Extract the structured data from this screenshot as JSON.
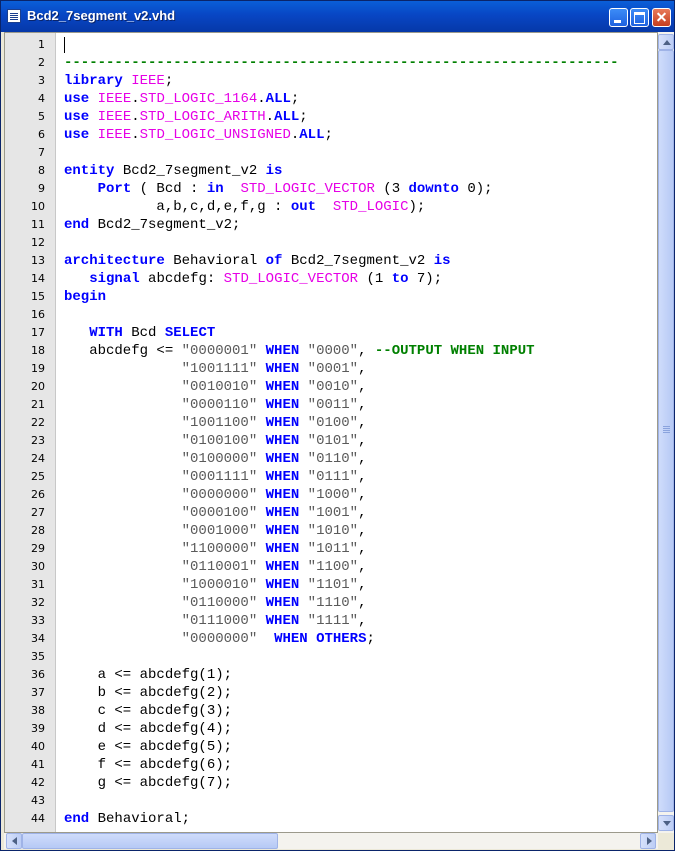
{
  "window": {
    "title": "Bcd2_7segment_v2.vhd"
  },
  "colors": {
    "keyword": "#0000ff",
    "type": "#e600e6",
    "comment": "#008000",
    "gutter": "#e6e6e6",
    "titlebar": "#0a5fd8"
  },
  "editor": {
    "lines": [
      {
        "n": "1",
        "tokens": []
      },
      {
        "n": "2",
        "tokens": [
          {
            "t": "------------------------------------------------------------------",
            "c": "cm"
          }
        ]
      },
      {
        "n": "3",
        "tokens": [
          {
            "t": "library",
            "c": "kw"
          },
          {
            "t": " "
          },
          {
            "t": "IEEE",
            "c": "ty"
          },
          {
            "t": ";"
          }
        ]
      },
      {
        "n": "4",
        "tokens": [
          {
            "t": "use",
            "c": "kw"
          },
          {
            "t": " "
          },
          {
            "t": "IEEE",
            "c": "ty"
          },
          {
            "t": "."
          },
          {
            "t": "STD_LOGIC_1164",
            "c": "ty"
          },
          {
            "t": "."
          },
          {
            "t": "ALL",
            "c": "kw"
          },
          {
            "t": ";"
          }
        ]
      },
      {
        "n": "5",
        "tokens": [
          {
            "t": "use",
            "c": "kw"
          },
          {
            "t": " "
          },
          {
            "t": "IEEE",
            "c": "ty"
          },
          {
            "t": "."
          },
          {
            "t": "STD_LOGIC_ARITH",
            "c": "ty"
          },
          {
            "t": "."
          },
          {
            "t": "ALL",
            "c": "kw"
          },
          {
            "t": ";"
          }
        ]
      },
      {
        "n": "6",
        "tokens": [
          {
            "t": "use",
            "c": "kw"
          },
          {
            "t": " "
          },
          {
            "t": "IEEE",
            "c": "ty"
          },
          {
            "t": "."
          },
          {
            "t": "STD_LOGIC_UNSIGNED",
            "c": "ty"
          },
          {
            "t": "."
          },
          {
            "t": "ALL",
            "c": "kw"
          },
          {
            "t": ";"
          }
        ]
      },
      {
        "n": "7",
        "tokens": []
      },
      {
        "n": "8",
        "tokens": [
          {
            "t": "entity",
            "c": "kw"
          },
          {
            "t": " Bcd2_7segment_v2 "
          },
          {
            "t": "is",
            "c": "kw"
          }
        ]
      },
      {
        "n": "9",
        "tokens": [
          {
            "t": "    "
          },
          {
            "t": "Port",
            "c": "kw"
          },
          {
            "t": " ( Bcd : "
          },
          {
            "t": "in",
            "c": "kw"
          },
          {
            "t": "  "
          },
          {
            "t": "STD_LOGIC_VECTOR",
            "c": "ty"
          },
          {
            "t": " (3 "
          },
          {
            "t": "downto",
            "c": "kw"
          },
          {
            "t": " 0);"
          }
        ]
      },
      {
        "n": "10",
        "tokens": [
          {
            "t": "           a,b,c,d,e,f,g : "
          },
          {
            "t": "out",
            "c": "kw"
          },
          {
            "t": "  "
          },
          {
            "t": "STD_LOGIC",
            "c": "ty"
          },
          {
            "t": ");"
          }
        ]
      },
      {
        "n": "11",
        "tokens": [
          {
            "t": "end",
            "c": "kw"
          },
          {
            "t": " Bcd2_7segment_v2;"
          }
        ]
      },
      {
        "n": "12",
        "tokens": []
      },
      {
        "n": "13",
        "tokens": [
          {
            "t": "architecture",
            "c": "kw"
          },
          {
            "t": " Behavioral "
          },
          {
            "t": "of",
            "c": "kw"
          },
          {
            "t": " Bcd2_7segment_v2 "
          },
          {
            "t": "is",
            "c": "kw"
          }
        ]
      },
      {
        "n": "14",
        "tokens": [
          {
            "t": "   "
          },
          {
            "t": "signal",
            "c": "kw"
          },
          {
            "t": " abcdefg: "
          },
          {
            "t": "STD_LOGIC_VECTOR",
            "c": "ty"
          },
          {
            "t": " (1 "
          },
          {
            "t": "to",
            "c": "kw"
          },
          {
            "t": " 7);"
          }
        ]
      },
      {
        "n": "15",
        "tokens": [
          {
            "t": "begin",
            "c": "kw"
          }
        ]
      },
      {
        "n": "16",
        "tokens": []
      },
      {
        "n": "17",
        "tokens": [
          {
            "t": "   "
          },
          {
            "t": "WITH",
            "c": "kw"
          },
          {
            "t": " Bcd "
          },
          {
            "t": "SELECT",
            "c": "kw"
          }
        ]
      },
      {
        "n": "18",
        "tokens": [
          {
            "t": "   abcdefg <= "
          },
          {
            "t": "\"0000001\"",
            "c": "st"
          },
          {
            "t": " "
          },
          {
            "t": "WHEN",
            "c": "kw"
          },
          {
            "t": " "
          },
          {
            "t": "\"0000\"",
            "c": "st"
          },
          {
            "t": ", "
          },
          {
            "t": "--OUTPUT WHEN INPUT",
            "c": "cm"
          }
        ]
      },
      {
        "n": "19",
        "tokens": [
          {
            "t": "              "
          },
          {
            "t": "\"1001111\"",
            "c": "st"
          },
          {
            "t": " "
          },
          {
            "t": "WHEN",
            "c": "kw"
          },
          {
            "t": " "
          },
          {
            "t": "\"0001\"",
            "c": "st"
          },
          {
            "t": ","
          }
        ]
      },
      {
        "n": "20",
        "tokens": [
          {
            "t": "              "
          },
          {
            "t": "\"0010010\"",
            "c": "st"
          },
          {
            "t": " "
          },
          {
            "t": "WHEN",
            "c": "kw"
          },
          {
            "t": " "
          },
          {
            "t": "\"0010\"",
            "c": "st"
          },
          {
            "t": ","
          }
        ]
      },
      {
        "n": "21",
        "tokens": [
          {
            "t": "              "
          },
          {
            "t": "\"0000110\"",
            "c": "st"
          },
          {
            "t": " "
          },
          {
            "t": "WHEN",
            "c": "kw"
          },
          {
            "t": " "
          },
          {
            "t": "\"0011\"",
            "c": "st"
          },
          {
            "t": ","
          }
        ]
      },
      {
        "n": "22",
        "tokens": [
          {
            "t": "              "
          },
          {
            "t": "\"1001100\"",
            "c": "st"
          },
          {
            "t": " "
          },
          {
            "t": "WHEN",
            "c": "kw"
          },
          {
            "t": " "
          },
          {
            "t": "\"0100\"",
            "c": "st"
          },
          {
            "t": ","
          }
        ]
      },
      {
        "n": "23",
        "tokens": [
          {
            "t": "              "
          },
          {
            "t": "\"0100100\"",
            "c": "st"
          },
          {
            "t": " "
          },
          {
            "t": "WHEN",
            "c": "kw"
          },
          {
            "t": " "
          },
          {
            "t": "\"0101\"",
            "c": "st"
          },
          {
            "t": ","
          }
        ]
      },
      {
        "n": "24",
        "tokens": [
          {
            "t": "              "
          },
          {
            "t": "\"0100000\"",
            "c": "st"
          },
          {
            "t": " "
          },
          {
            "t": "WHEN",
            "c": "kw"
          },
          {
            "t": " "
          },
          {
            "t": "\"0110\"",
            "c": "st"
          },
          {
            "t": ","
          }
        ]
      },
      {
        "n": "25",
        "tokens": [
          {
            "t": "              "
          },
          {
            "t": "\"0001111\"",
            "c": "st"
          },
          {
            "t": " "
          },
          {
            "t": "WHEN",
            "c": "kw"
          },
          {
            "t": " "
          },
          {
            "t": "\"0111\"",
            "c": "st"
          },
          {
            "t": ","
          }
        ]
      },
      {
        "n": "26",
        "tokens": [
          {
            "t": "              "
          },
          {
            "t": "\"0000000\"",
            "c": "st"
          },
          {
            "t": " "
          },
          {
            "t": "WHEN",
            "c": "kw"
          },
          {
            "t": " "
          },
          {
            "t": "\"1000\"",
            "c": "st"
          },
          {
            "t": ","
          }
        ]
      },
      {
        "n": "27",
        "tokens": [
          {
            "t": "              "
          },
          {
            "t": "\"0000100\"",
            "c": "st"
          },
          {
            "t": " "
          },
          {
            "t": "WHEN",
            "c": "kw"
          },
          {
            "t": " "
          },
          {
            "t": "\"1001\"",
            "c": "st"
          },
          {
            "t": ","
          }
        ]
      },
      {
        "n": "28",
        "tokens": [
          {
            "t": "              "
          },
          {
            "t": "\"0001000\"",
            "c": "st"
          },
          {
            "t": " "
          },
          {
            "t": "WHEN",
            "c": "kw"
          },
          {
            "t": " "
          },
          {
            "t": "\"1010\"",
            "c": "st"
          },
          {
            "t": ","
          }
        ]
      },
      {
        "n": "29",
        "tokens": [
          {
            "t": "              "
          },
          {
            "t": "\"1100000\"",
            "c": "st"
          },
          {
            "t": " "
          },
          {
            "t": "WHEN",
            "c": "kw"
          },
          {
            "t": " "
          },
          {
            "t": "\"1011\"",
            "c": "st"
          },
          {
            "t": ","
          }
        ]
      },
      {
        "n": "30",
        "tokens": [
          {
            "t": "              "
          },
          {
            "t": "\"0110001\"",
            "c": "st"
          },
          {
            "t": " "
          },
          {
            "t": "WHEN",
            "c": "kw"
          },
          {
            "t": " "
          },
          {
            "t": "\"1100\"",
            "c": "st"
          },
          {
            "t": ","
          }
        ]
      },
      {
        "n": "31",
        "tokens": [
          {
            "t": "              "
          },
          {
            "t": "\"1000010\"",
            "c": "st"
          },
          {
            "t": " "
          },
          {
            "t": "WHEN",
            "c": "kw"
          },
          {
            "t": " "
          },
          {
            "t": "\"1101\"",
            "c": "st"
          },
          {
            "t": ","
          }
        ]
      },
      {
        "n": "32",
        "tokens": [
          {
            "t": "              "
          },
          {
            "t": "\"0110000\"",
            "c": "st"
          },
          {
            "t": " "
          },
          {
            "t": "WHEN",
            "c": "kw"
          },
          {
            "t": " "
          },
          {
            "t": "\"1110\"",
            "c": "st"
          },
          {
            "t": ","
          }
        ]
      },
      {
        "n": "33",
        "tokens": [
          {
            "t": "              "
          },
          {
            "t": "\"0111000\"",
            "c": "st"
          },
          {
            "t": " "
          },
          {
            "t": "WHEN",
            "c": "kw"
          },
          {
            "t": " "
          },
          {
            "t": "\"1111\"",
            "c": "st"
          },
          {
            "t": ","
          }
        ]
      },
      {
        "n": "34",
        "tokens": [
          {
            "t": "              "
          },
          {
            "t": "\"0000000\"",
            "c": "st"
          },
          {
            "t": "  "
          },
          {
            "t": "WHEN",
            "c": "kw"
          },
          {
            "t": " "
          },
          {
            "t": "OTHERS",
            "c": "kw"
          },
          {
            "t": ";"
          }
        ]
      },
      {
        "n": "35",
        "tokens": []
      },
      {
        "n": "36",
        "tokens": [
          {
            "t": "    a <= abcdefg(1);"
          }
        ]
      },
      {
        "n": "37",
        "tokens": [
          {
            "t": "    b <= abcdefg(2);"
          }
        ]
      },
      {
        "n": "38",
        "tokens": [
          {
            "t": "    c <= abcdefg(3);"
          }
        ]
      },
      {
        "n": "39",
        "tokens": [
          {
            "t": "    d <= abcdefg(4);"
          }
        ]
      },
      {
        "n": "40",
        "tokens": [
          {
            "t": "    e <= abcdefg(5);"
          }
        ]
      },
      {
        "n": "41",
        "tokens": [
          {
            "t": "    f <= abcdefg(6);"
          }
        ]
      },
      {
        "n": "42",
        "tokens": [
          {
            "t": "    g <= abcdefg(7);"
          }
        ]
      },
      {
        "n": "43",
        "tokens": []
      },
      {
        "n": "44",
        "tokens": [
          {
            "t": "end",
            "c": "kw"
          },
          {
            "t": " Behavioral;"
          }
        ]
      }
    ]
  }
}
